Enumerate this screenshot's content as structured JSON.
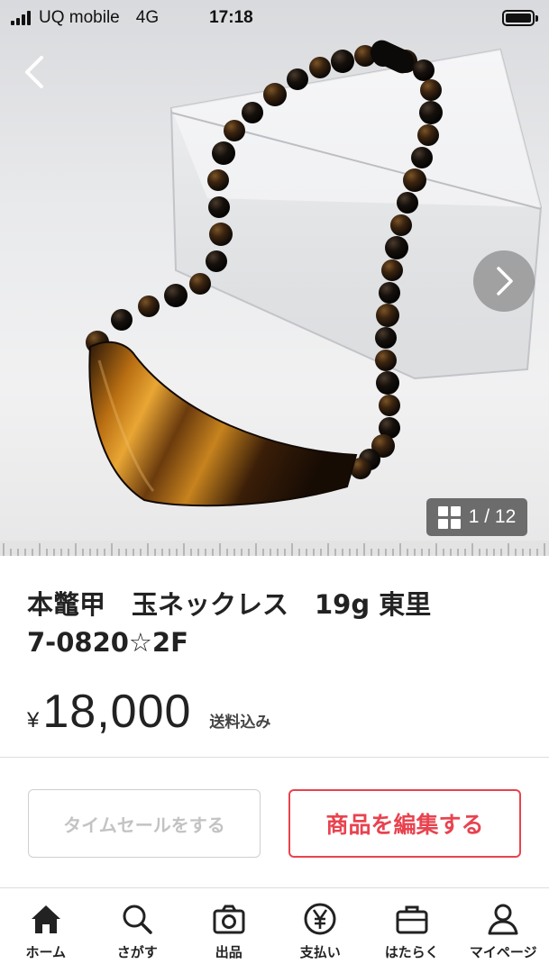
{
  "status_bar": {
    "carrier": "UQ mobile",
    "network": "4G",
    "time": "17:18"
  },
  "gallery": {
    "counter": "1 / 12",
    "icons": {
      "back": "chevron-left-icon",
      "next": "chevron-right-icon",
      "grid": "grid-icon"
    }
  },
  "product": {
    "title_line1": "本鼈甲　玉ネックレス　19g 東里",
    "title_line2": "7-0820☆2F",
    "currency": "¥",
    "price": "18,000",
    "shipping": "送料込み"
  },
  "actions": {
    "time_sale": "タイムセールをする",
    "edit": "商品を編集する"
  },
  "colors": {
    "accent": "#e8434f",
    "disabled_text": "#c3c3c3"
  },
  "tabbar": {
    "items": [
      {
        "label": "ホーム",
        "icon": "home-icon"
      },
      {
        "label": "さがす",
        "icon": "search-icon"
      },
      {
        "label": "出品",
        "icon": "camera-icon"
      },
      {
        "label": "支払い",
        "icon": "yen-icon"
      },
      {
        "label": "はたらく",
        "icon": "briefcase-icon"
      },
      {
        "label": "マイページ",
        "icon": "person-icon"
      }
    ]
  }
}
